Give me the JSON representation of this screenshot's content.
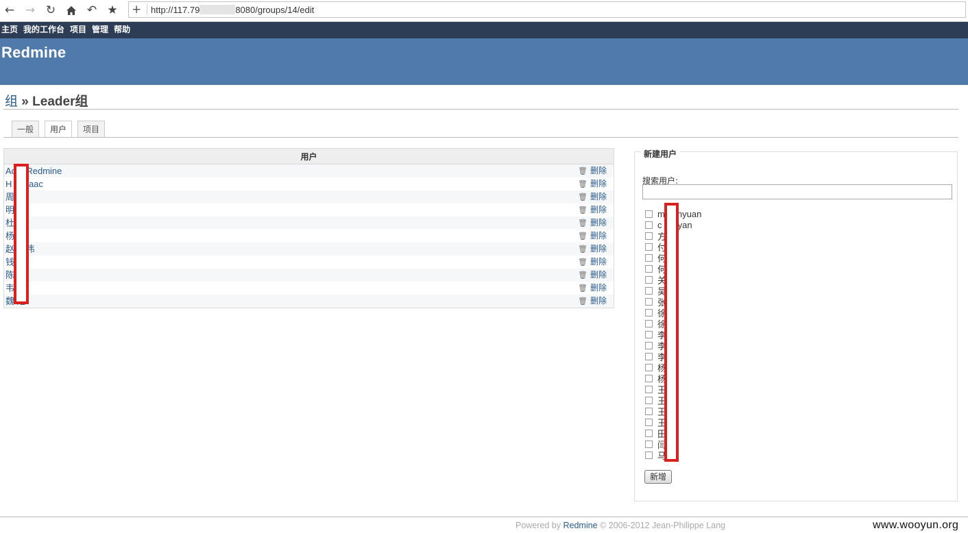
{
  "browser": {
    "url_prefix": "http://117.79",
    "url_suffix": "8080/groups/14/edit"
  },
  "top_menu": [
    "主页",
    "我的工作台",
    "项目",
    "管理",
    "帮助"
  ],
  "header": {
    "title": "Redmine"
  },
  "breadcrumb": {
    "parent": "组",
    "separator": "»",
    "current": "Leader组"
  },
  "tabs": [
    {
      "label": "一般",
      "selected": false
    },
    {
      "label": "用户",
      "selected": true
    },
    {
      "label": "项目",
      "selected": false
    }
  ],
  "users_table": {
    "header": "用户",
    "delete_label": "删除",
    "rows": [
      "Ad  n Redmine",
      "H   g Isaac",
      "周",
      "明",
      "杜",
      "杨",
      "赵  国伟",
      "钱",
      "陈",
      "韦",
      "魏   旭"
    ]
  },
  "new_user": {
    "legend": "新建用户",
    "search_label": "搜索用户:",
    "search_value": "",
    "add_button": "新增",
    "candidates": [
      "m   hanyuan",
      "c    weiyan",
      "方",
      "付    宇",
      "何",
      "何",
      "关    馨",
      "吴    洲",
      "张",
      "徐    男",
      "徐    然",
      "李",
      "李",
      "李    清",
      "杨    明",
      "杨",
      "王    峰",
      "王    兴",
      "王",
      "王    达",
      "田    杰",
      "闫    庆",
      "马    丽"
    ]
  },
  "footer": {
    "powered_by": "Powered by",
    "brand": "Redmine",
    "copyright": "© 2006-2012 Jean-Philippe Lang"
  },
  "watermark": "www.wooyun.org"
}
